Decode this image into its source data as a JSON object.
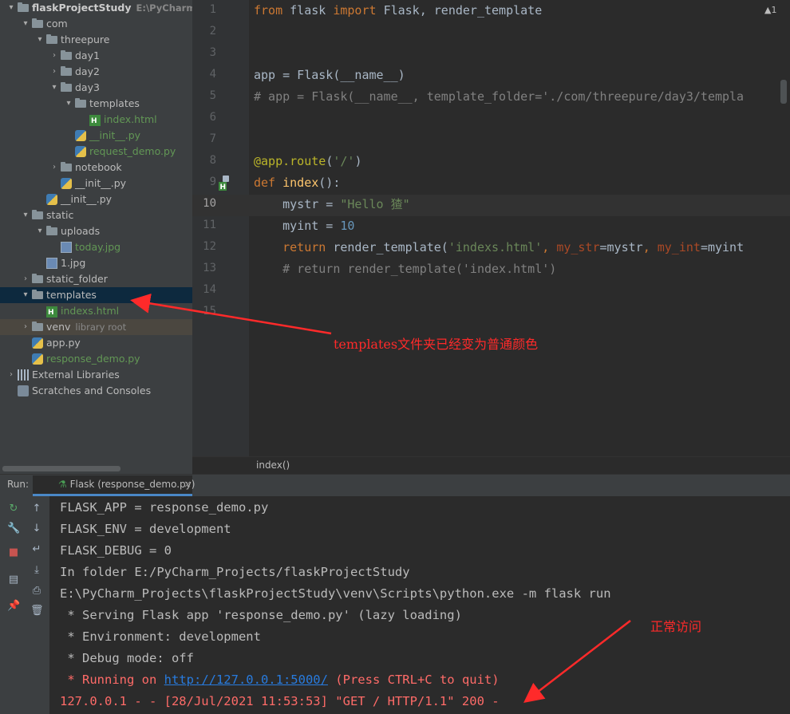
{
  "project_tree": [
    {
      "label": "flaskProjectStudy",
      "suffix": "E:\\PyCharm_Pr",
      "indent": 0,
      "arrow": "▾",
      "icon": "folder",
      "style": "bold"
    },
    {
      "label": "com",
      "indent": 1,
      "arrow": "▾",
      "icon": "folder"
    },
    {
      "label": "threepure",
      "indent": 2,
      "arrow": "▾",
      "icon": "folder"
    },
    {
      "label": "day1",
      "indent": 3,
      "arrow": "›",
      "icon": "folder"
    },
    {
      "label": "day2",
      "indent": 3,
      "arrow": "›",
      "icon": "folder"
    },
    {
      "label": "day3",
      "indent": 3,
      "arrow": "▾",
      "icon": "folder"
    },
    {
      "label": "templates",
      "indent": 4,
      "arrow": "▾",
      "icon": "folder"
    },
    {
      "label": "index.html",
      "indent": 5,
      "arrow": "",
      "icon": "html",
      "style": "green"
    },
    {
      "label": "__init__.py",
      "indent": 4,
      "arrow": "",
      "icon": "py",
      "style": "green"
    },
    {
      "label": "request_demo.py",
      "indent": 4,
      "arrow": "",
      "icon": "py",
      "style": "green"
    },
    {
      "label": "notebook",
      "indent": 3,
      "arrow": "›",
      "icon": "folder"
    },
    {
      "label": "__init__.py",
      "indent": 3,
      "arrow": "",
      "icon": "py"
    },
    {
      "label": "__init__.py",
      "indent": 2,
      "arrow": "",
      "icon": "py"
    },
    {
      "label": "static",
      "indent": 1,
      "arrow": "▾",
      "icon": "folder"
    },
    {
      "label": "uploads",
      "indent": 2,
      "arrow": "▾",
      "icon": "folder"
    },
    {
      "label": "today.jpg",
      "indent": 3,
      "arrow": "",
      "icon": "img",
      "style": "green"
    },
    {
      "label": "1.jpg",
      "indent": 2,
      "arrow": "",
      "icon": "img"
    },
    {
      "label": "static_folder",
      "indent": 1,
      "arrow": "›",
      "icon": "folder"
    },
    {
      "label": "templates",
      "indent": 1,
      "arrow": "▾",
      "icon": "folder",
      "selected": true
    },
    {
      "label": "indexs.html",
      "indent": 2,
      "arrow": "",
      "icon": "html",
      "style": "green"
    },
    {
      "label": "venv",
      "suffix": "library root",
      "indent": 1,
      "arrow": "›",
      "icon": "folder",
      "lib": true
    },
    {
      "label": "app.py",
      "indent": 1,
      "arrow": "",
      "icon": "py"
    },
    {
      "label": "response_demo.py",
      "indent": 1,
      "arrow": "",
      "icon": "py",
      "style": "green"
    },
    {
      "label": "External Libraries",
      "indent": 0,
      "arrow": "›",
      "icon": "lib"
    },
    {
      "label": "Scratches and Consoles",
      "indent": 0,
      "arrow": "",
      "icon": "scr"
    }
  ],
  "editor": {
    "line_numbers": [
      "1",
      "2",
      "3",
      "4",
      "5",
      "6",
      "7",
      "8",
      "9",
      "10",
      "11",
      "12",
      "13",
      "14",
      "15"
    ],
    "current_line": "10",
    "warning_count": "▲1",
    "breadcrumb": "index()",
    "lines": [
      [
        [
          "kw",
          "from "
        ],
        [
          "",
          "flask "
        ],
        [
          "kw",
          "import "
        ],
        [
          "",
          "Flask, render_template"
        ]
      ],
      [],
      [],
      [
        [
          "",
          "app = Flask(__name__)"
        ]
      ],
      [
        [
          "cmt",
          "# app = Flask(__name__, template_folder='./com/threepure/day3/templa"
        ]
      ],
      [],
      [],
      [
        [
          "dec",
          "@app.route"
        ],
        [
          "",
          "("
        ],
        [
          "str",
          "'/'"
        ],
        [
          "",
          ")"
        ]
      ],
      [
        [
          "kw",
          "def "
        ],
        [
          "fn",
          "index"
        ],
        [
          "",
          "():"
        ]
      ],
      [
        [
          "",
          "    mystr = "
        ],
        [
          "str",
          "\"Hello 猹\""
        ]
      ],
      [
        [
          "",
          "    myint = "
        ],
        [
          "num",
          "10"
        ]
      ],
      [
        [
          "kw",
          "    return "
        ],
        [
          "",
          "render_template("
        ],
        [
          "str",
          "'indexs.html'"
        ],
        [
          "kw",
          ", "
        ],
        [
          "param",
          "my_str"
        ],
        [
          "",
          "=mystr"
        ],
        [
          "kw",
          ", "
        ],
        [
          "param",
          "my_int"
        ],
        [
          "",
          "=myint"
        ]
      ],
      [
        [
          "cmt",
          "    # return render_template('index.html')"
        ]
      ],
      [],
      []
    ]
  },
  "run": {
    "label": "Run:",
    "tab": "Flask (response_demo.py)",
    "tab_close": "×",
    "console": [
      [
        [
          "",
          "FLASK_APP = response_demo.py"
        ]
      ],
      [
        [
          "",
          "FLASK_ENV = development"
        ]
      ],
      [
        [
          "",
          "FLASK_DEBUG = 0"
        ]
      ],
      [
        [
          "",
          "In folder E:/PyCharm_Projects/flaskProjectStudy"
        ]
      ],
      [
        [
          "",
          "E:\\PyCharm_Projects\\flaskProjectStudy\\venv\\Scripts\\python.exe -m flask run"
        ]
      ],
      [
        [
          "",
          " * Serving Flask app 'response_demo.py' (lazy loading)"
        ]
      ],
      [
        [
          "",
          " * Environment: development"
        ]
      ],
      [
        [
          "",
          " * Debug mode: off"
        ]
      ],
      [
        [
          "red",
          " * Running on "
        ],
        [
          "link",
          "http://127.0.0.1:5000/"
        ],
        [
          "red",
          " (Press CTRL+C to quit)"
        ]
      ],
      [
        [
          "red",
          "127.0.0.1 - - [28/Jul/2021 11:53:53] \"GET / HTTP/1.1\" 200 -"
        ]
      ]
    ]
  },
  "annotations": {
    "templates_note": "templates文件夹已经变为普通颜色",
    "access_note": "正常访问"
  },
  "icons": {
    "rerun": "↻",
    "wrench": "🔧",
    "stop": "■",
    "layout": "▤",
    "pin": "📌",
    "up": "↑",
    "down": "↓",
    "wrap": "↵",
    "scroll_end": "⤓",
    "print": "⎙",
    "trash": "🗑"
  }
}
